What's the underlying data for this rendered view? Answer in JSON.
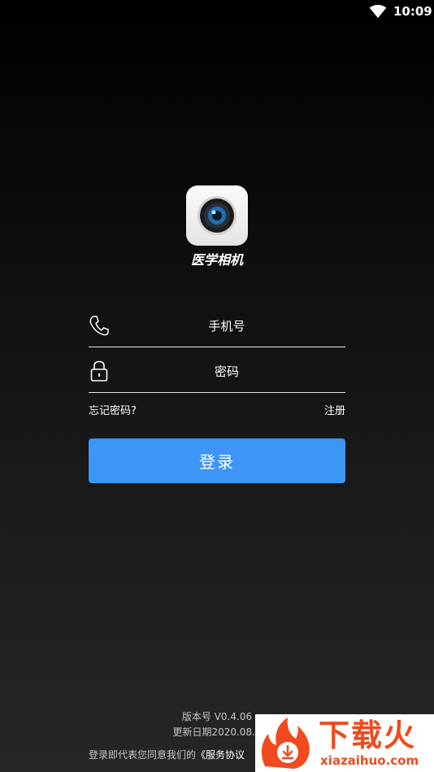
{
  "status_bar": {
    "time": "10:09"
  },
  "app": {
    "name": "医学相机"
  },
  "form": {
    "phone_placeholder": "手机号",
    "password_placeholder": "密码",
    "forgot_label": "忘记密码?",
    "register_label": "注册",
    "login_label": "登录"
  },
  "footer": {
    "version": "版本号 V0.4.06",
    "update_date": "更新日期2020.08.0",
    "agreement_prefix": "登录即代表您同意我们的",
    "agreement_link": "《服务协议"
  },
  "watermark": {
    "title": "下载火",
    "url": "xiazaihuo.com"
  },
  "colors": {
    "primary": "#3d95f5",
    "watermark": "#f04a1e"
  }
}
